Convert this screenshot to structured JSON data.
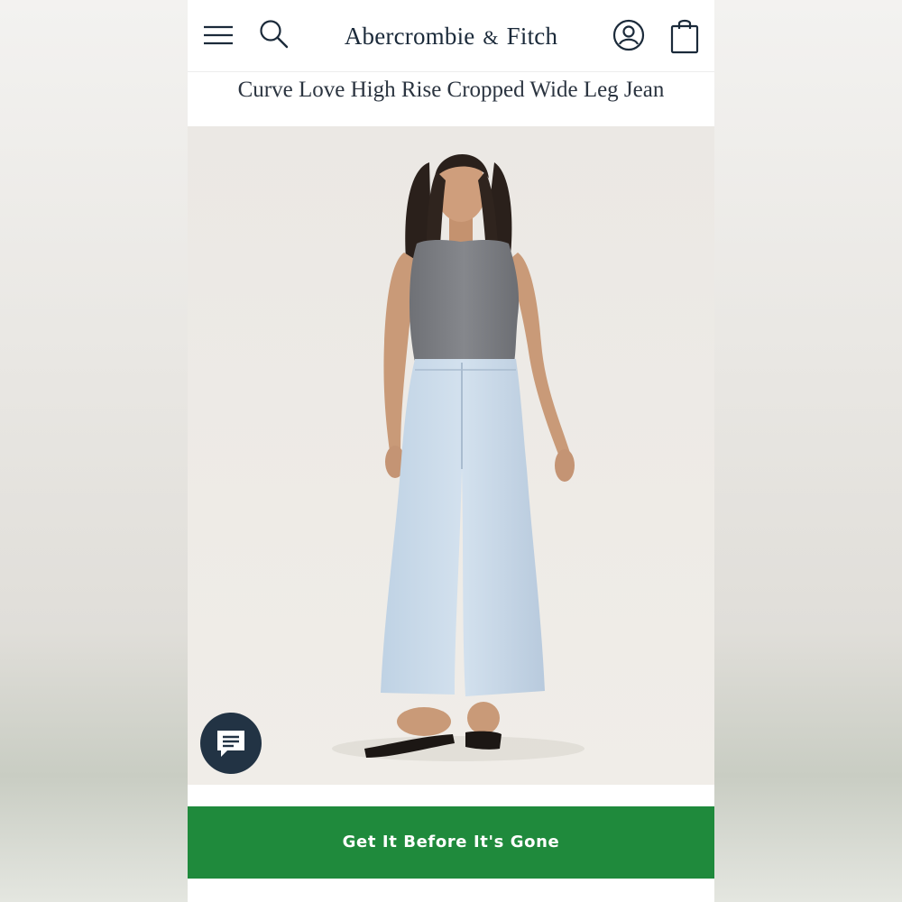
{
  "header": {
    "brand_name": "Abercrombie",
    "brand_amp": "&",
    "brand_suffix": "Fitch",
    "icons": [
      "menu-icon",
      "search-icon",
      "account-icon",
      "shopping-bag-icon"
    ]
  },
  "product": {
    "title": "Curve Love High Rise Cropped Wide Leg Jean",
    "image_description_icon": "model-photo"
  },
  "chat": {
    "icon": "chat-bubble-icon"
  },
  "cta": {
    "label": "Get It Before It's Gone"
  },
  "colors": {
    "brand_navy": "#1b2a3a",
    "cta_green": "#1f8a3c",
    "chat_bg": "#223344",
    "denim": "#c9d9e8",
    "top_gray": "#7d7f84"
  }
}
